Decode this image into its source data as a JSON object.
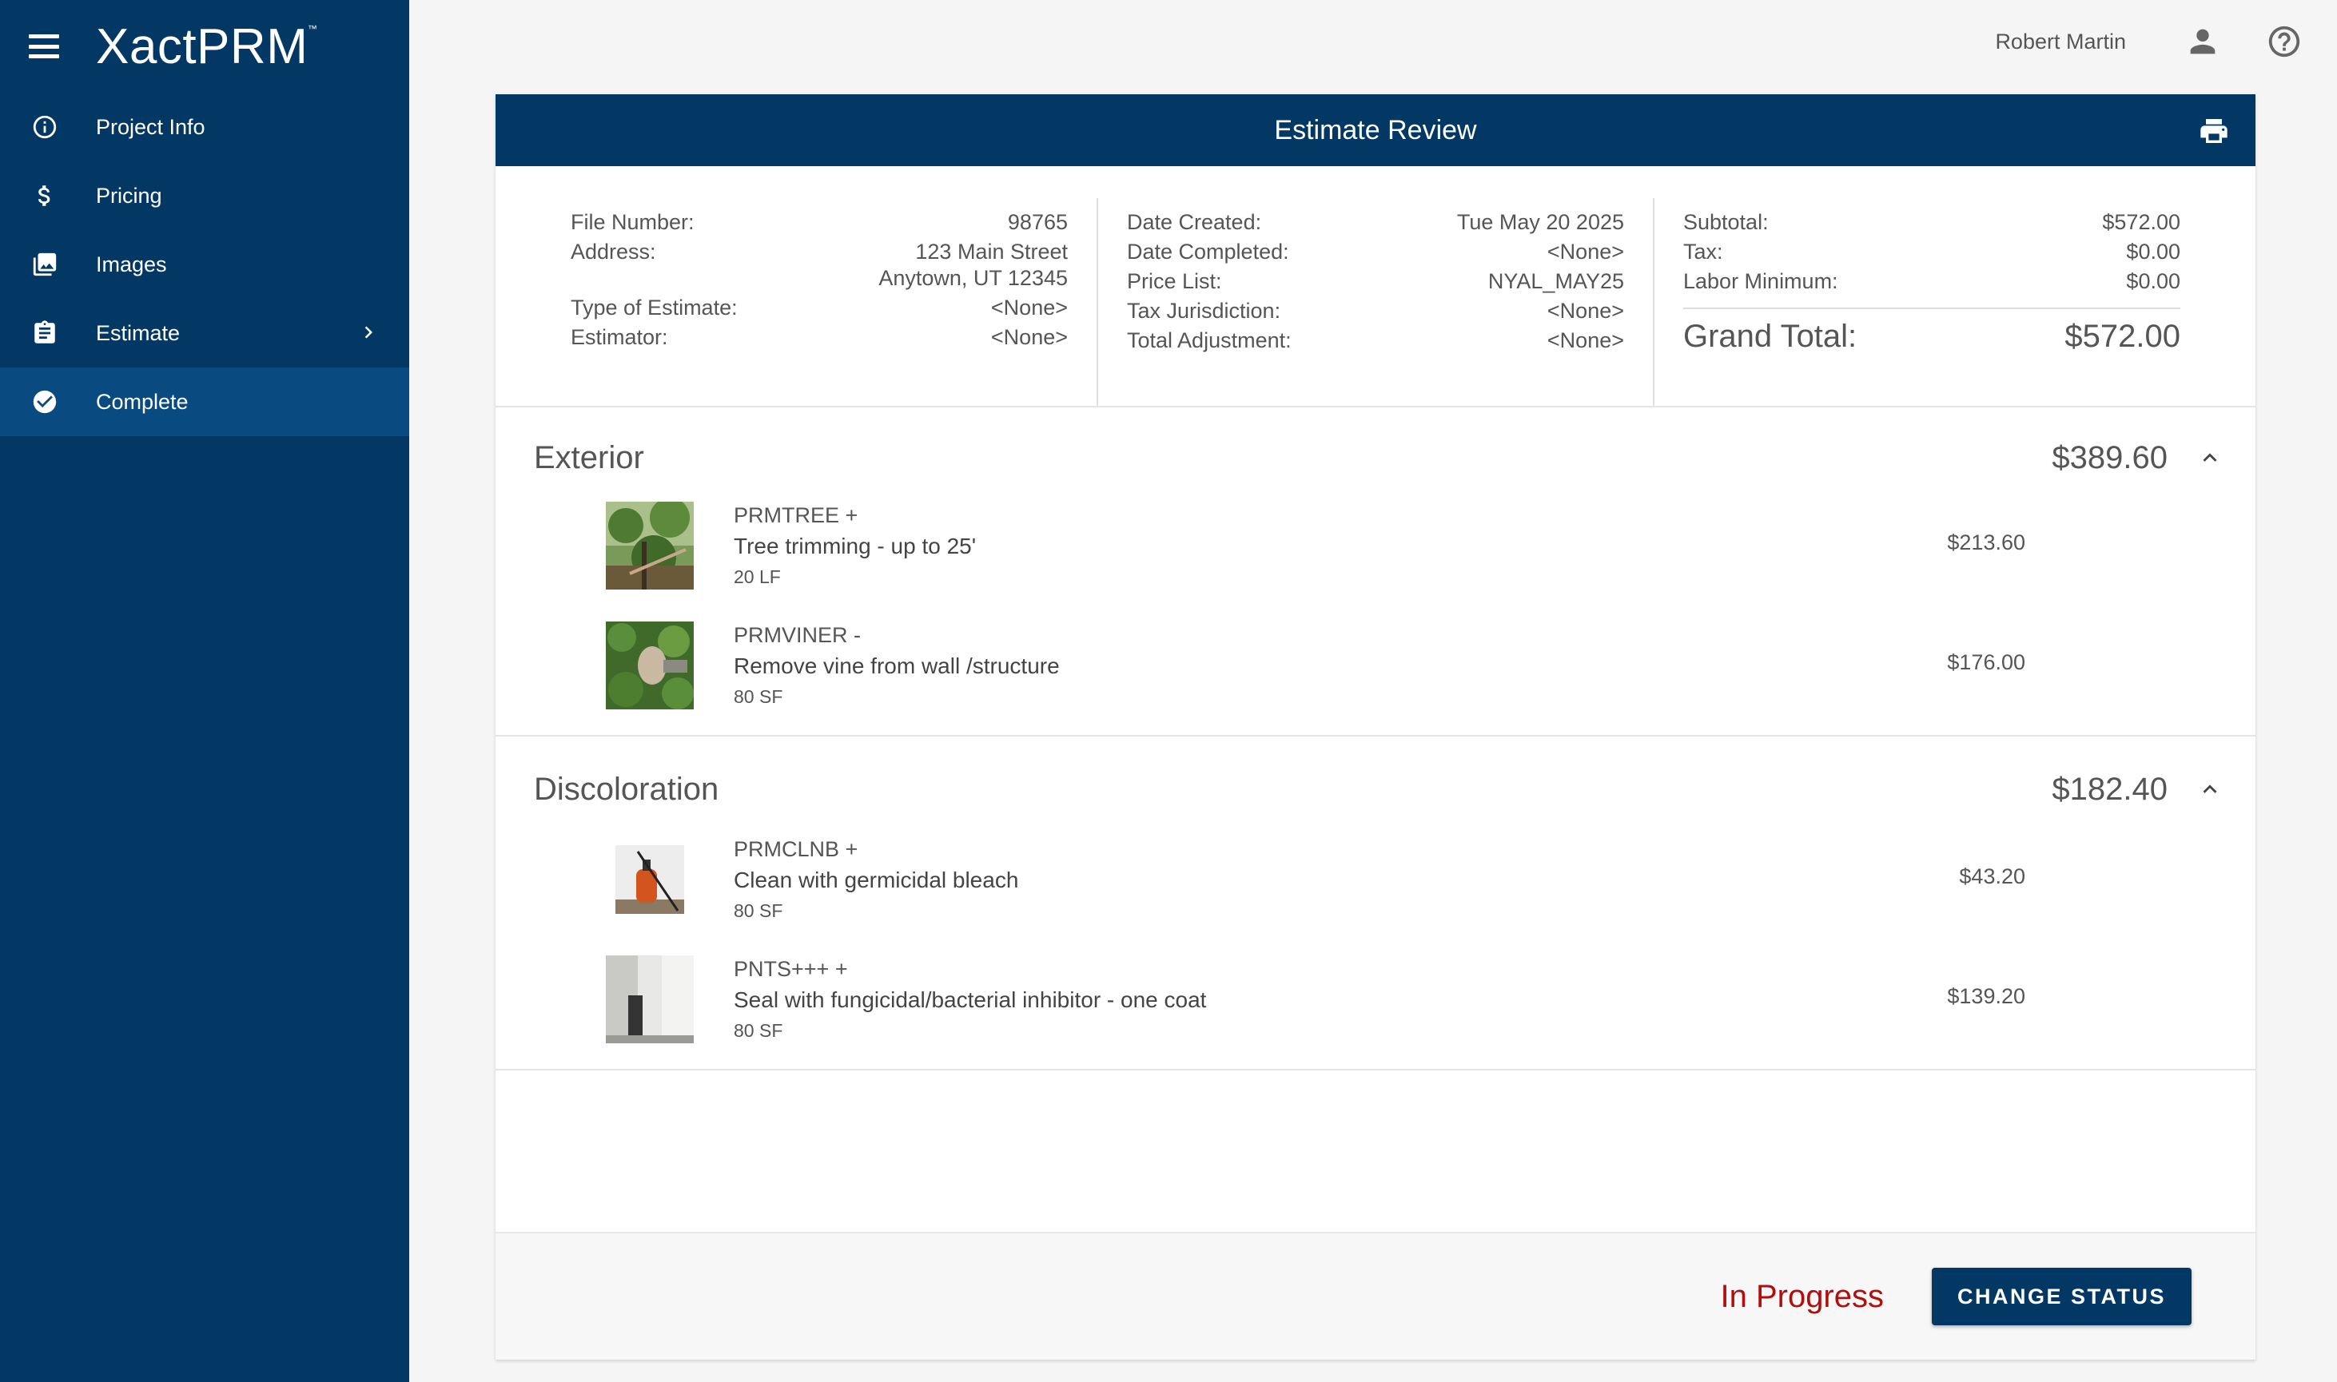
{
  "app": {
    "brand": "XactPRM",
    "trademark": "™",
    "user_name": "Robert Martin"
  },
  "sidebar": {
    "items": [
      {
        "label": "Project Info",
        "icon": "info-icon"
      },
      {
        "label": "Pricing",
        "icon": "dollar-icon"
      },
      {
        "label": "Images",
        "icon": "image-icon"
      },
      {
        "label": "Estimate",
        "icon": "clipboard-icon"
      },
      {
        "label": "Complete",
        "icon": "check-circle-icon",
        "active": true
      }
    ]
  },
  "card": {
    "title": "Estimate Review"
  },
  "summary": {
    "left": [
      {
        "label": "File Number:",
        "value": "98765"
      },
      {
        "label": "Address:",
        "value": "123 Main Street",
        "value2": "Anytown, UT 12345"
      },
      {
        "label": "Type of Estimate:",
        "value": "<None>"
      },
      {
        "label": "Estimator:",
        "value": "<None>"
      }
    ],
    "middle": [
      {
        "label": "Date Created:",
        "value": "Tue May 20 2025"
      },
      {
        "label": "Date Completed:",
        "value": "<None>"
      },
      {
        "label": "Price List:",
        "value": "NYAL_MAY25"
      },
      {
        "label": "Tax Jurisdiction:",
        "value": "<None>"
      },
      {
        "label": "Total Adjustment:",
        "value": "<None>"
      }
    ],
    "right": [
      {
        "label": "Subtotal:",
        "value": "$572.00"
      },
      {
        "label": "Tax:",
        "value": "$0.00"
      },
      {
        "label": "Labor Minimum:",
        "value": "$0.00"
      }
    ],
    "grand_total_label": "Grand Total:",
    "grand_total_value": "$572.00"
  },
  "sections": [
    {
      "title": "Exterior",
      "total": "$389.60",
      "items": [
        {
          "code": "PRMTREE +",
          "desc": "Tree trimming - up to 25'",
          "qty": "20 LF",
          "price": "$213.60"
        },
        {
          "code": "PRMVINER -",
          "desc": "Remove vine from wall /structure",
          "qty": "80 SF",
          "price": "$176.00"
        }
      ]
    },
    {
      "title": "Discoloration",
      "total": "$182.40",
      "items": [
        {
          "code": "PRMCLNB +",
          "desc": "Clean with germicidal bleach",
          "qty": "80 SF",
          "price": "$43.20"
        },
        {
          "code": "PNTS+++ +",
          "desc": "Seal with fungicidal/bacterial inhibitor - one coat",
          "qty": "80 SF",
          "price": "$139.20"
        }
      ]
    }
  ],
  "footer": {
    "status": "In Progress",
    "button": "CHANGE STATUS"
  },
  "colors": {
    "brand_navy": "#033865",
    "active_nav": "#094a80",
    "status_red": "#b20e0e"
  }
}
